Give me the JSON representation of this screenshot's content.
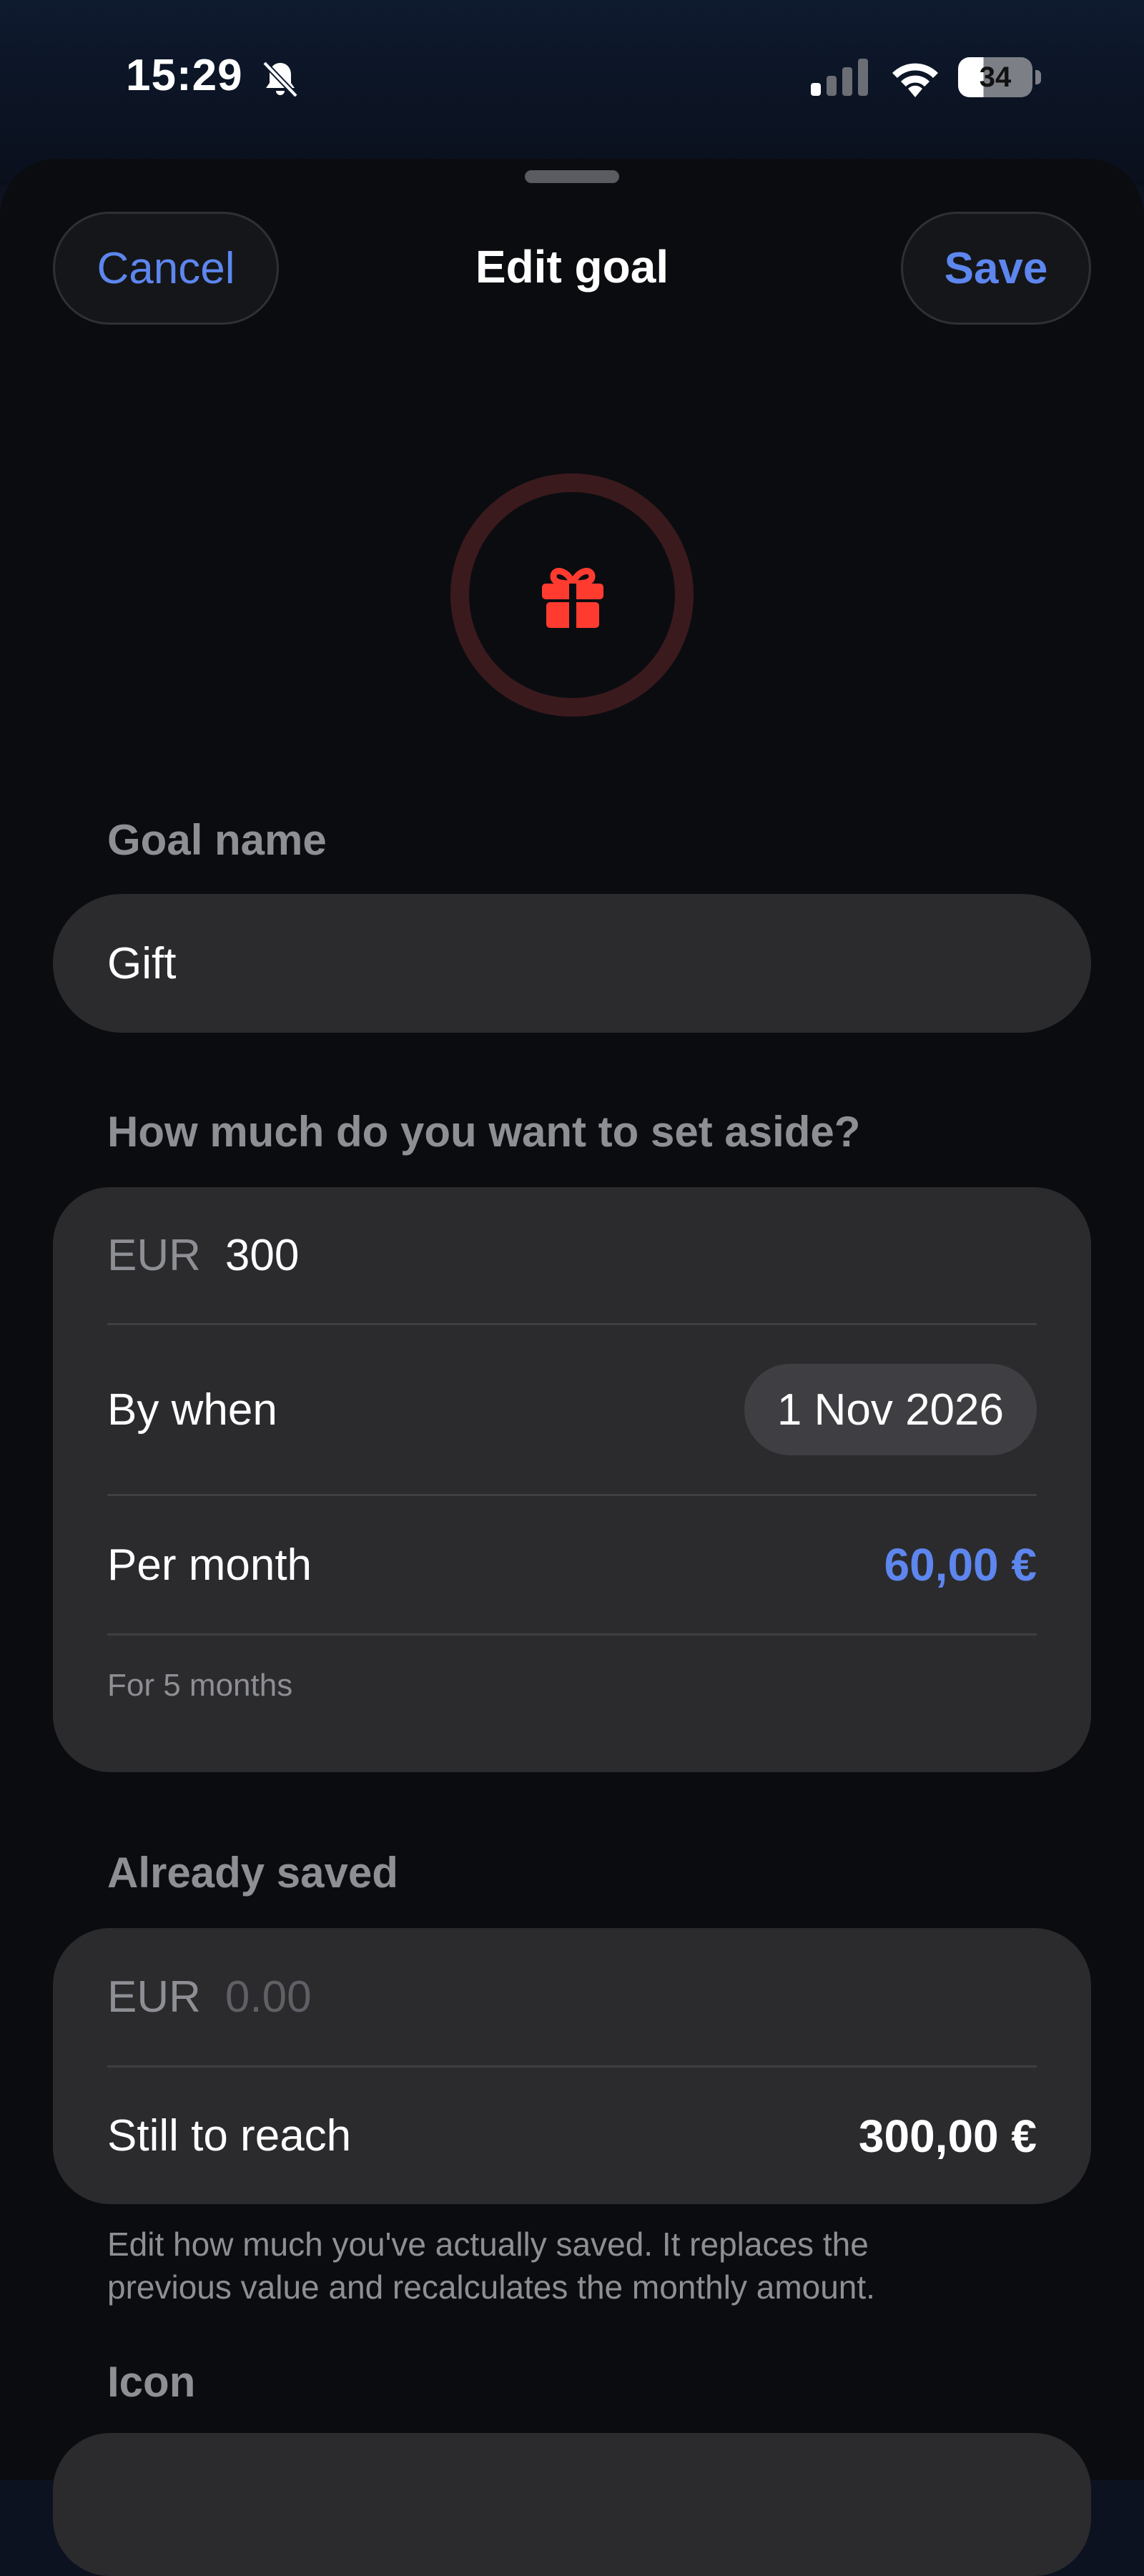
{
  "status_bar": {
    "time": "15:29",
    "battery": "34",
    "icons": [
      "bell-slash-icon",
      "cellular-signal-icon",
      "wifi-icon",
      "battery-icon"
    ]
  },
  "header": {
    "cancel_label": "Cancel",
    "title": "Edit goal",
    "save_label": "Save"
  },
  "goal_icon": {
    "name": "gift-icon",
    "color": "#ff3b30"
  },
  "goal_name": {
    "label": "Goal name",
    "value": "Gift"
  },
  "target": {
    "label": "How much do you want to set aside?",
    "currency": "EUR",
    "amount": "300",
    "by_when_label": "By when",
    "by_when_value": "1 Nov 2026",
    "per_month_label": "Per month",
    "per_month_value": "60,00 €",
    "note": "For 5 months"
  },
  "saved": {
    "label": "Already saved",
    "currency": "EUR",
    "placeholder": "0.00",
    "still_label": "Still to reach",
    "still_value": "300,00 €",
    "helper_line1": "Edit how much you've actually saved. It replaces the",
    "helper_line2": "previous value and recalculates the monthly amount."
  },
  "icon_section": {
    "label": "Icon"
  },
  "colors": {
    "accent": "#5d86ee",
    "card": "#2b2b2e",
    "sheet": "#0b0c10",
    "gift": "#ff3b30"
  }
}
